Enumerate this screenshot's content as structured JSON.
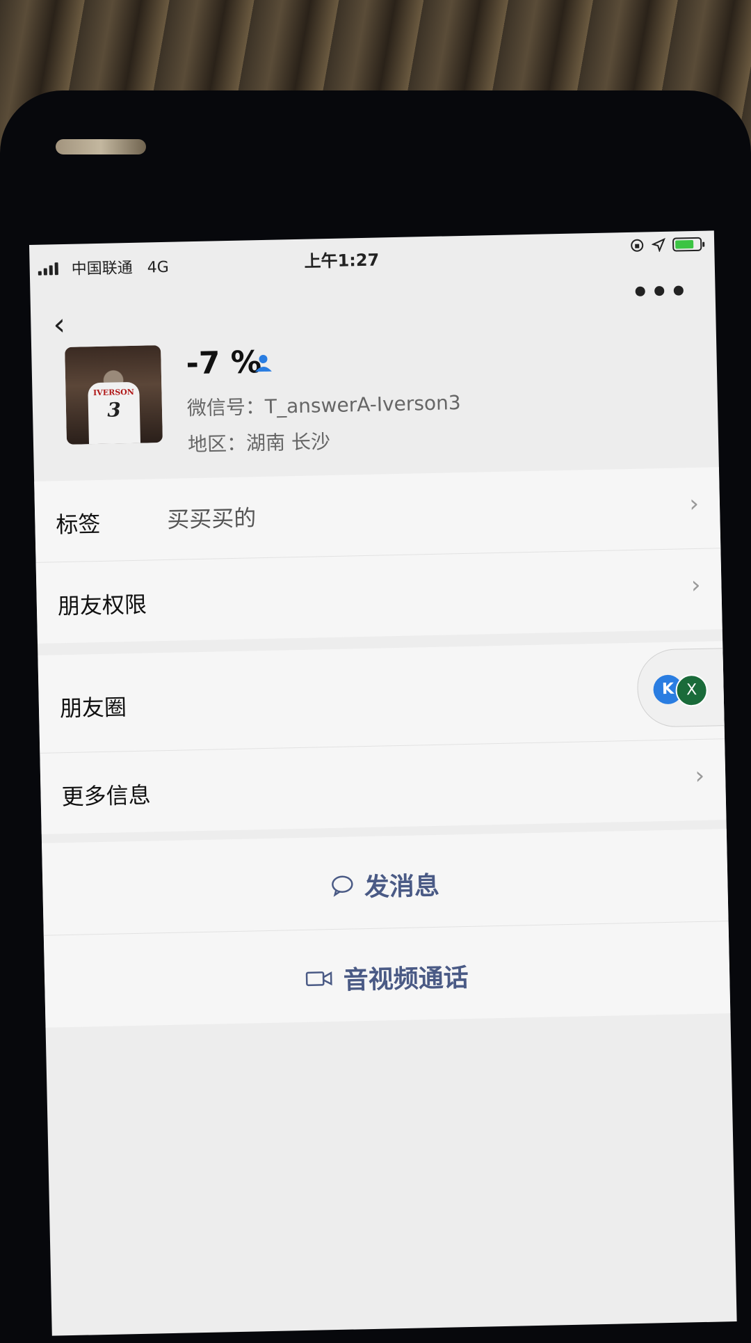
{
  "status_bar": {
    "carrier": "中国联通",
    "network": "4G",
    "time": "上午1:27"
  },
  "nav": {
    "back_icon": "‹",
    "more_icon": "•••"
  },
  "profile": {
    "nickname": "-7 %",
    "wechat_id": "微信号：T_answerA-Iverson3",
    "region": "地区：湖南 长沙",
    "avatar_jersey_name": "IVERSON",
    "avatar_jersey_number": "3"
  },
  "list": {
    "tags_label": "标签",
    "tags_value": "买买买的",
    "friend_permission_label": "朋友权限",
    "moments_label": "朋友圈",
    "more_info_label": "更多信息",
    "chevron": "›"
  },
  "floating": {
    "app_badge": "K",
    "close_badge": "X"
  },
  "actions": {
    "send_message": "发消息",
    "video_call": "音视频通话"
  },
  "colors": {
    "action_text": "#4a5a85",
    "screen_bg": "#ededed",
    "battery_fill": "#3cc443"
  }
}
